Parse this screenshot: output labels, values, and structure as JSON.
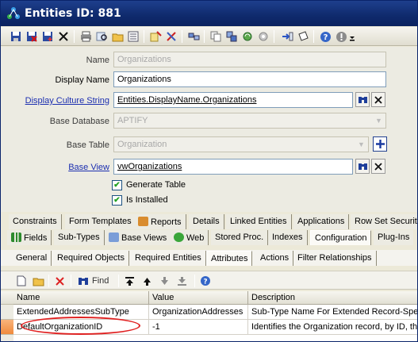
{
  "window": {
    "title": "Entities ID: 881"
  },
  "toolbar": {
    "buttons": [
      "save-icon",
      "save-close-icon",
      "save-new-icon",
      "delete-icon",
      "print-icon",
      "search-icon",
      "open-folder-icon",
      "list-icon",
      "wizard-icon",
      "tools-icon",
      "layout-icon",
      "copy-icon",
      "merge-icon",
      "refresh-icon",
      "settings-icon",
      "export-icon",
      "note-icon",
      "help-icon",
      "info-icon",
      "overflow-icon"
    ]
  },
  "form": {
    "name": {
      "label": "Name",
      "value": "Organizations"
    },
    "display_name": {
      "label": "Display Name",
      "value": "Organizations"
    },
    "display_culture_string": {
      "label": "Display Culture String",
      "value": "Entities.DisplayName.Organizations"
    },
    "base_database": {
      "label": "Base Database",
      "value": "APTIFY"
    },
    "base_table": {
      "label": "Base Table",
      "value": "Organization"
    },
    "base_view": {
      "label": "Base View",
      "value": "vwOrganizations"
    },
    "generate_table": {
      "label": "Generate Table",
      "checked": true
    },
    "is_installed": {
      "label": "Is Installed",
      "checked": true
    }
  },
  "tabs_row1": [
    "Constraints",
    "Form Templates",
    "Reports",
    "Details",
    "Linked Entities",
    "Applications",
    "Row Set Security"
  ],
  "tabs_row2": [
    "Fields",
    "Sub-Types",
    "Base Views",
    "Web",
    "Stored Proc.",
    "Indexes",
    "Configuration",
    "Plug-Ins"
  ],
  "tabs_row3": [
    "General",
    "Required Objects",
    "Required Entities",
    "Attributes",
    "Actions",
    "Filter Relationships"
  ],
  "grid_toolbar": {
    "find_label": "Find"
  },
  "grid": {
    "columns": [
      "Name",
      "Value",
      "Description"
    ],
    "rows": [
      {
        "name": "ExtendedAddressesSubType",
        "value": "OrganizationAddresses",
        "description": "Sub-Type Name For Extended Record-Specific Addresses"
      },
      {
        "name": "DefaultOrganizationID",
        "value": "-1",
        "description": "Identifies the Organization record, by ID, that represents the default"
      }
    ]
  },
  "colors": {
    "title_bar": "#0f2a6c",
    "link": "#1c2fb0",
    "highlight": "#e02020",
    "selected_row_header": "#f08a3c"
  }
}
